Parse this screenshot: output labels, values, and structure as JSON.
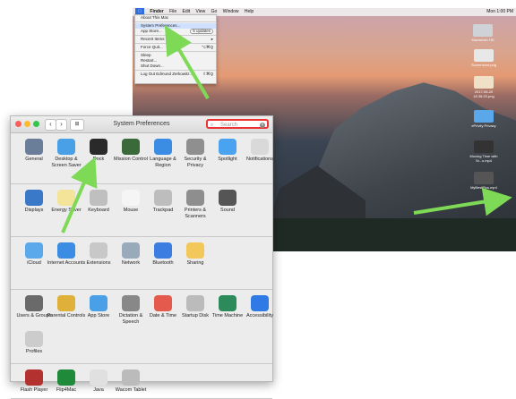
{
  "menubar": {
    "apple": "",
    "app": "Finder",
    "items": [
      "File",
      "Edit",
      "View",
      "Go",
      "Window",
      "Help"
    ],
    "status": "Mon 1:00 PM"
  },
  "apple_menu": {
    "items": [
      {
        "label": "About This Mac",
        "hl": false
      },
      {
        "sep": true
      },
      {
        "label": "System Preferences...",
        "hl": true
      },
      {
        "label": "App Store...",
        "hl": false,
        "pill": "5 updates"
      },
      {
        "sep": true
      },
      {
        "label": "Recent Items",
        "hl": false,
        "right": "▸"
      },
      {
        "sep": true
      },
      {
        "label": "Force Quit...",
        "hl": false,
        "right": "⌥⌘Q"
      },
      {
        "sep": true
      },
      {
        "label": "Sleep",
        "hl": false
      },
      {
        "label": "Restart...",
        "hl": false
      },
      {
        "label": "Shut Down...",
        "hl": false
      },
      {
        "sep": true
      },
      {
        "label": "Log Out Edmund Zerkowitz...",
        "hl": false,
        "right": "⇧⌘Q"
      }
    ]
  },
  "desktop_icons": [
    {
      "label": "Macintosh HD",
      "color": "#cfd3d8"
    },
    {
      "label": "Screenshot.png",
      "color": "#e8e8e8"
    },
    {
      "label": "2017-06-20 18.38.20.png",
      "color": "#f0e0c8"
    },
    {
      "label": "ePrivity Privacy",
      "color": "#5aa7ea"
    },
    {
      "label": "Moving Time with Sr...s.mp4",
      "color": "#333"
    },
    {
      "label": "MyBestPics.mp4",
      "color": "#555"
    }
  ],
  "window": {
    "title": "System Preferences",
    "search": {
      "placeholder": "Search"
    },
    "sections": [
      [
        {
          "label": "General",
          "icon": "general-icon",
          "color": "#6a7d99"
        },
        {
          "label": "Desktop & Screen Saver",
          "icon": "desktop-icon",
          "color": "#4aa0e6"
        },
        {
          "label": "Dock",
          "icon": "dock-icon",
          "color": "#2a2a2a"
        },
        {
          "label": "Mission Control",
          "icon": "mission-control-icon",
          "color": "#3a6a3a"
        },
        {
          "label": "Language & Region",
          "icon": "language-icon",
          "color": "#3b8de3"
        },
        {
          "label": "Security & Privacy",
          "icon": "security-icon",
          "color": "#8f8f8f"
        },
        {
          "label": "Spotlight",
          "icon": "spotlight-icon",
          "color": "#4aa3f0"
        },
        {
          "label": "Notifications",
          "icon": "notifications-icon",
          "color": "#d9d9d9"
        }
      ],
      [
        {
          "label": "Displays",
          "icon": "displays-icon",
          "color": "#3a78c8"
        },
        {
          "label": "Energy Saver",
          "icon": "energy-icon",
          "color": "#f4e49a"
        },
        {
          "label": "Keyboard",
          "icon": "keyboard-icon",
          "color": "#bfbfbf"
        },
        {
          "label": "Mouse",
          "icon": "mouse-icon",
          "color": "#f5f5f5"
        },
        {
          "label": "Trackpad",
          "icon": "trackpad-icon",
          "color": "#bdbdbd"
        },
        {
          "label": "Printers & Scanners",
          "icon": "printer-icon",
          "color": "#8e8e8e"
        },
        {
          "label": "Sound",
          "icon": "sound-icon",
          "color": "#555"
        }
      ],
      [
        {
          "label": "iCloud",
          "icon": "icloud-icon",
          "color": "#5aa9ea"
        },
        {
          "label": "Internet Accounts",
          "icon": "internet-accounts-icon",
          "color": "#3b8de3"
        },
        {
          "label": "Extensions",
          "icon": "extensions-icon",
          "color": "#c8c8c8"
        },
        {
          "label": "Network",
          "icon": "network-icon",
          "color": "#9ab"
        },
        {
          "label": "Bluetooth",
          "icon": "bluetooth-icon",
          "color": "#3b7de0"
        },
        {
          "label": "Sharing",
          "icon": "sharing-icon",
          "color": "#f2c85a"
        }
      ],
      [
        {
          "label": "Users & Groups",
          "icon": "users-icon",
          "color": "#6a6a6a"
        },
        {
          "label": "Parental Controls",
          "icon": "parental-icon",
          "color": "#e0b13a"
        },
        {
          "label": "App Store",
          "icon": "appstore-icon",
          "color": "#4aa0e6"
        },
        {
          "label": "Dictation & Speech",
          "icon": "dictation-icon",
          "color": "#888"
        },
        {
          "label": "Date & Time",
          "icon": "date-time-icon",
          "color": "#e45b4e"
        },
        {
          "label": "Startup Disk",
          "icon": "startup-disk-icon",
          "color": "#bbb"
        },
        {
          "label": "Time Machine",
          "icon": "time-machine-icon",
          "color": "#2d8a5a"
        },
        {
          "label": "Accessibility",
          "icon": "accessibility-icon",
          "color": "#2f7ae5"
        },
        {
          "label": "Profiles",
          "icon": "profiles-icon",
          "color": "#ccc"
        }
      ],
      [
        {
          "label": "Flash Player",
          "icon": "flash-icon",
          "color": "#b3312e"
        },
        {
          "label": "Flip4Mac",
          "icon": "flip4mac-icon",
          "color": "#1f8a3a"
        },
        {
          "label": "Java",
          "icon": "java-icon",
          "color": "#e0e0e0"
        },
        {
          "label": "Wacom Tablet",
          "icon": "wacom-icon",
          "color": "#bbb"
        }
      ]
    ]
  },
  "colors": {
    "accent": "#2f6fe0",
    "arrow": "#7ed957",
    "search_border": "#e33333"
  }
}
